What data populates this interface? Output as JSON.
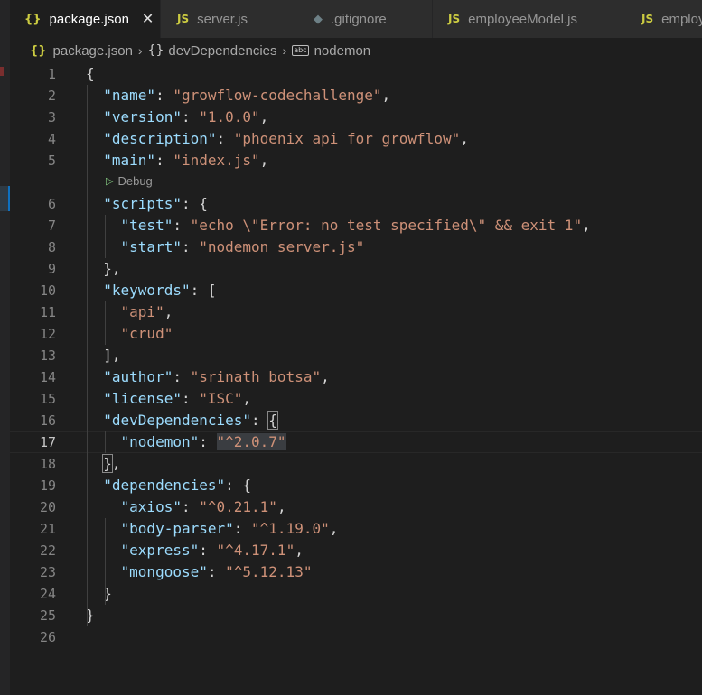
{
  "tabs": [
    {
      "label": "package.json",
      "icon": "{}",
      "active": true
    },
    {
      "label": "server.js",
      "icon": "JS"
    },
    {
      "label": ".gitignore",
      "icon": "◆"
    },
    {
      "label": "employeeModel.js",
      "icon": "JS"
    },
    {
      "label": "employ",
      "icon": "JS"
    }
  ],
  "close_icon": "✕",
  "breadcrumb": {
    "file_icon": "{}",
    "file": "package.json",
    "section_icon": "{}",
    "section": "devDependencies",
    "field_icon": "abc",
    "field": "nodemon"
  },
  "codelens": {
    "label": "Debug"
  },
  "current_line": 17,
  "lines": [
    {
      "n": "1",
      "tokens": [
        {
          "t": "{",
          "c": "p"
        }
      ]
    },
    {
      "n": "2",
      "tokens": [
        {
          "t": "  "
        },
        {
          "t": "\"name\"",
          "c": "k"
        },
        {
          "t": ": "
        },
        {
          "t": "\"growflow-codechallenge\"",
          "c": "s"
        },
        {
          "t": ","
        }
      ]
    },
    {
      "n": "3",
      "tokens": [
        {
          "t": "  "
        },
        {
          "t": "\"version\"",
          "c": "k"
        },
        {
          "t": ": "
        },
        {
          "t": "\"1.0.0\"",
          "c": "s"
        },
        {
          "t": ","
        }
      ]
    },
    {
      "n": "4",
      "tokens": [
        {
          "t": "  "
        },
        {
          "t": "\"description\"",
          "c": "k"
        },
        {
          "t": ": "
        },
        {
          "t": "\"phoenix api for growflow\"",
          "c": "s"
        },
        {
          "t": ","
        }
      ]
    },
    {
      "n": "5",
      "tokens": [
        {
          "t": "  "
        },
        {
          "t": "\"main\"",
          "c": "k"
        },
        {
          "t": ": "
        },
        {
          "t": "\"index.js\"",
          "c": "s"
        },
        {
          "t": ","
        }
      ]
    },
    {
      "n": "6",
      "tokens": [
        {
          "t": "  "
        },
        {
          "t": "\"scripts\"",
          "c": "k"
        },
        {
          "t": ": {"
        }
      ]
    },
    {
      "n": "7",
      "tokens": [
        {
          "t": "    "
        },
        {
          "t": "\"test\"",
          "c": "k"
        },
        {
          "t": ": "
        },
        {
          "t": "\"echo \\\"Error: no test specified\\\" && exit 1\"",
          "c": "s"
        },
        {
          "t": ","
        }
      ]
    },
    {
      "n": "8",
      "tokens": [
        {
          "t": "    "
        },
        {
          "t": "\"start\"",
          "c": "k"
        },
        {
          "t": ": "
        },
        {
          "t": "\"nodemon server.js\"",
          "c": "s"
        }
      ]
    },
    {
      "n": "9",
      "tokens": [
        {
          "t": "  },"
        }
      ]
    },
    {
      "n": "10",
      "tokens": [
        {
          "t": "  "
        },
        {
          "t": "\"keywords\"",
          "c": "k"
        },
        {
          "t": ": ["
        }
      ]
    },
    {
      "n": "11",
      "tokens": [
        {
          "t": "    "
        },
        {
          "t": "\"api\"",
          "c": "s"
        },
        {
          "t": ","
        }
      ]
    },
    {
      "n": "12",
      "tokens": [
        {
          "t": "    "
        },
        {
          "t": "\"crud\"",
          "c": "s"
        }
      ]
    },
    {
      "n": "13",
      "tokens": [
        {
          "t": "  ],"
        }
      ]
    },
    {
      "n": "14",
      "tokens": [
        {
          "t": "  "
        },
        {
          "t": "\"author\"",
          "c": "k"
        },
        {
          "t": ": "
        },
        {
          "t": "\"srinath botsa\"",
          "c": "s"
        },
        {
          "t": ","
        }
      ]
    },
    {
      "n": "15",
      "tokens": [
        {
          "t": "  "
        },
        {
          "t": "\"license\"",
          "c": "k"
        },
        {
          "t": ": "
        },
        {
          "t": "\"ISC\"",
          "c": "s"
        },
        {
          "t": ","
        }
      ]
    },
    {
      "n": "16",
      "tokens": [
        {
          "t": "  "
        },
        {
          "t": "\"devDependencies\"",
          "c": "k"
        },
        {
          "t": ": "
        },
        {
          "t": "{",
          "c": "p",
          "m": "bm"
        }
      ]
    },
    {
      "n": "17",
      "tokens": [
        {
          "t": "    "
        },
        {
          "t": "\"nodemon\"",
          "c": "k"
        },
        {
          "t": ": "
        },
        {
          "t": "\"^2.0.7\"",
          "c": "s",
          "m": "hl"
        }
      ]
    },
    {
      "n": "18",
      "tokens": [
        {
          "t": "  "
        },
        {
          "t": "}",
          "c": "p",
          "m": "bm"
        },
        {
          "t": ","
        }
      ]
    },
    {
      "n": "19",
      "tokens": [
        {
          "t": "  "
        },
        {
          "t": "\"dependencies\"",
          "c": "k"
        },
        {
          "t": ": {"
        }
      ]
    },
    {
      "n": "20",
      "tokens": [
        {
          "t": "    "
        },
        {
          "t": "\"axios\"",
          "c": "k"
        },
        {
          "t": ": "
        },
        {
          "t": "\"^0.21.1\"",
          "c": "s"
        },
        {
          "t": ","
        }
      ]
    },
    {
      "n": "21",
      "tokens": [
        {
          "t": "    "
        },
        {
          "t": "\"body-parser\"",
          "c": "k"
        },
        {
          "t": ": "
        },
        {
          "t": "\"^1.19.0\"",
          "c": "s"
        },
        {
          "t": ","
        }
      ]
    },
    {
      "n": "22",
      "tokens": [
        {
          "t": "    "
        },
        {
          "t": "\"express\"",
          "c": "k"
        },
        {
          "t": ": "
        },
        {
          "t": "\"^4.17.1\"",
          "c": "s"
        },
        {
          "t": ","
        }
      ]
    },
    {
      "n": "23",
      "tokens": [
        {
          "t": "    "
        },
        {
          "t": "\"mongoose\"",
          "c": "k"
        },
        {
          "t": ": "
        },
        {
          "t": "\"^5.12.13\"",
          "c": "s"
        }
      ]
    },
    {
      "n": "24",
      "tokens": [
        {
          "t": "  }"
        }
      ]
    },
    {
      "n": "25",
      "tokens": [
        {
          "t": "}"
        }
      ]
    },
    {
      "n": "26",
      "tokens": []
    }
  ]
}
